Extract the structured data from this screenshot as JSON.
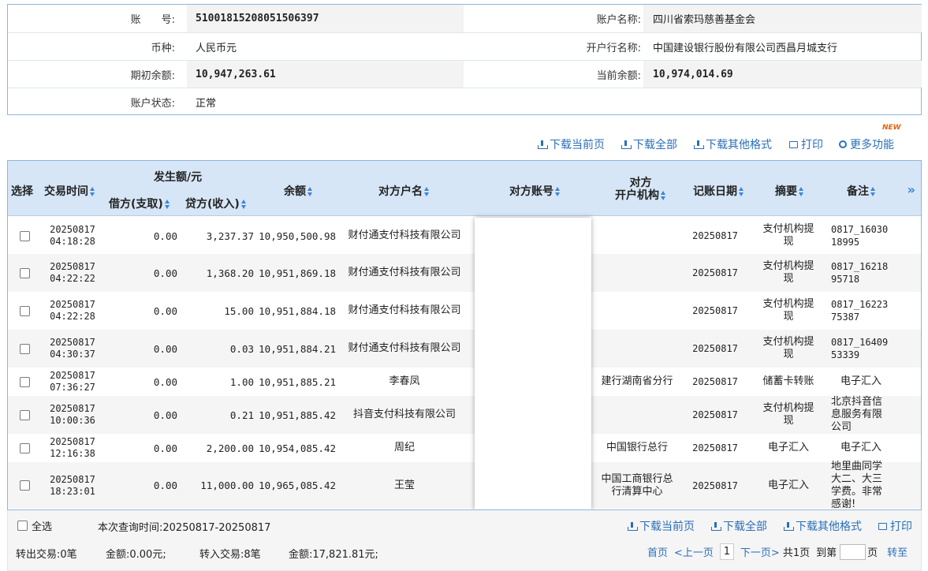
{
  "account": {
    "account_no_label": "账　　号:",
    "account_no": "51001815208051506397",
    "account_name_label": "账户名称:",
    "account_name": "四川省索玛慈善基金会",
    "currency_label": "币种:",
    "currency": "人民币元",
    "bank_label": "开户行名称:",
    "bank": "中国建设银行股份有限公司西昌月城支行",
    "opening_balance_label": "期初余额:",
    "opening_balance": "10,947,263.61",
    "current_balance_label": "当前余额:",
    "current_balance": "10,974,014.69",
    "status_label": "账户状态:",
    "status": "正常"
  },
  "toolbar": {
    "download_page": "下载当前页",
    "download_all": "下载全部",
    "download_other": "下载其他格式",
    "print": "打印",
    "more": "更多功能",
    "new_badge": "NEW"
  },
  "table": {
    "headers": {
      "select": "选择",
      "time": "交易时间",
      "amount_group": "发生额/元",
      "debit": "借方(支取)",
      "credit": "贷方(收入)",
      "balance": "余额",
      "party_name": "对方户名",
      "party_account": "对方账号",
      "party_bank_l1": "对方",
      "party_bank_l2": "开户机构",
      "post_date": "记账日期",
      "summary": "摘要",
      "remark": "备注",
      "more_cols": "»"
    },
    "rows": [
      {
        "date": "20250817",
        "time": "04:18:28",
        "debit": "0.00",
        "credit": "3,237.37",
        "balance": "10,950,500.98",
        "party": "财付通支付科技有限公司",
        "bank": "",
        "post": "20250817",
        "summary": "支付机构提现",
        "remark": "0817_1603018995"
      },
      {
        "date": "20250817",
        "time": "04:22:22",
        "debit": "0.00",
        "credit": "1,368.20",
        "balance": "10,951,869.18",
        "party": "财付通支付科技有限公司",
        "bank": "",
        "post": "20250817",
        "summary": "支付机构提现",
        "remark": "0817_1621895718"
      },
      {
        "date": "20250817",
        "time": "04:22:28",
        "debit": "0.00",
        "credit": "15.00",
        "balance": "10,951,884.18",
        "party": "财付通支付科技有限公司",
        "bank": "",
        "post": "20250817",
        "summary": "支付机构提现",
        "remark": "0817_1622375387"
      },
      {
        "date": "20250817",
        "time": "04:30:37",
        "debit": "0.00",
        "credit": "0.03",
        "balance": "10,951,884.21",
        "party": "财付通支付科技有限公司",
        "bank": "",
        "post": "20250817",
        "summary": "支付机构提现",
        "remark": "0817_1640953339"
      },
      {
        "date": "20250817",
        "time": "07:36:27",
        "debit": "0.00",
        "credit": "1.00",
        "balance": "10,951,885.21",
        "party": "李春凤",
        "bank": "建行湖南省分行",
        "post": "20250817",
        "summary": "储蓄卡转账",
        "remark": "电子汇入"
      },
      {
        "date": "20250817",
        "time": "10:00:36",
        "debit": "0.00",
        "credit": "0.21",
        "balance": "10,951,885.42",
        "party": "抖音支付科技有限公司",
        "bank": "",
        "post": "20250817",
        "summary": "支付机构提现",
        "remark": "北京抖音信息服务有限公司"
      },
      {
        "date": "20250817",
        "time": "12:16:38",
        "debit": "0.00",
        "credit": "2,200.00",
        "balance": "10,954,085.42",
        "party": "周纪",
        "bank": "中国银行总行",
        "post": "20250817",
        "summary": "电子汇入",
        "remark": "电子汇入"
      },
      {
        "date": "20250817",
        "time": "18:23:01",
        "debit": "0.00",
        "credit": "11,000.00",
        "balance": "10,965,085.42",
        "party": "王莹",
        "bank": "中国工商银行总行清算中心",
        "post": "20250817",
        "summary": "电子汇入",
        "remark": "地里曲同学大二、大三学费。非常感谢!"
      }
    ]
  },
  "footer": {
    "select_all": "全选",
    "query_time": "本次查询时间:20250817-20250817",
    "download_page": "下载当前页",
    "download_all": "下载全部",
    "download_other": "下载其他格式",
    "print": "打印",
    "out_txn": "转出交易:0笔",
    "out_amount": "金额:0.00元;",
    "in_txn": "转入交易:8笔",
    "in_amount": "金额:17,821.81元;",
    "first_page": "首页",
    "prev_page": "<上一页",
    "page_no": "1",
    "next_page": "下一页>",
    "total_pages": "共1页",
    "goto_label": "到第",
    "goto_suffix": "页",
    "go": "转至"
  }
}
